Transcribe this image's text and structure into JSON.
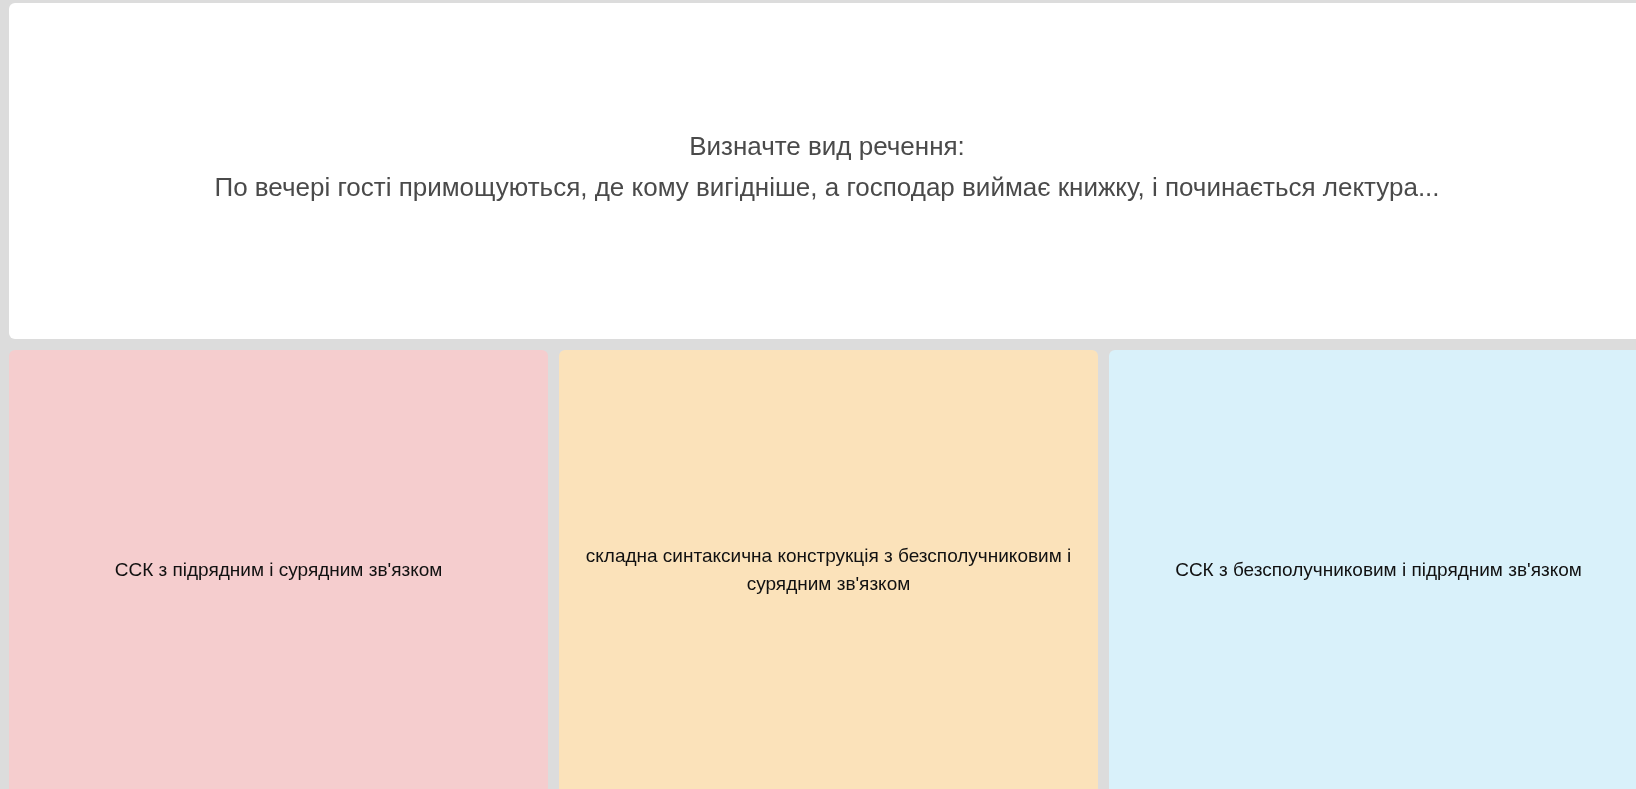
{
  "question": {
    "prompt": "Визначте вид речення:",
    "sentence": "По вечері гості примощуються, де кому вигідніше, а господар виймає книжку, і починається лектура..."
  },
  "answers": [
    {
      "label": "ССК з підрядним і сурядним зв'язком",
      "color": "#f5cdce"
    },
    {
      "label": "складна синтаксична конструкція з безсполучниковим і сурядним зв'язком",
      "color": "#fbe2ba"
    },
    {
      "label": "ССК з безсполучниковим і підрядним зв'язком",
      "color": "#d9f1fa"
    }
  ]
}
